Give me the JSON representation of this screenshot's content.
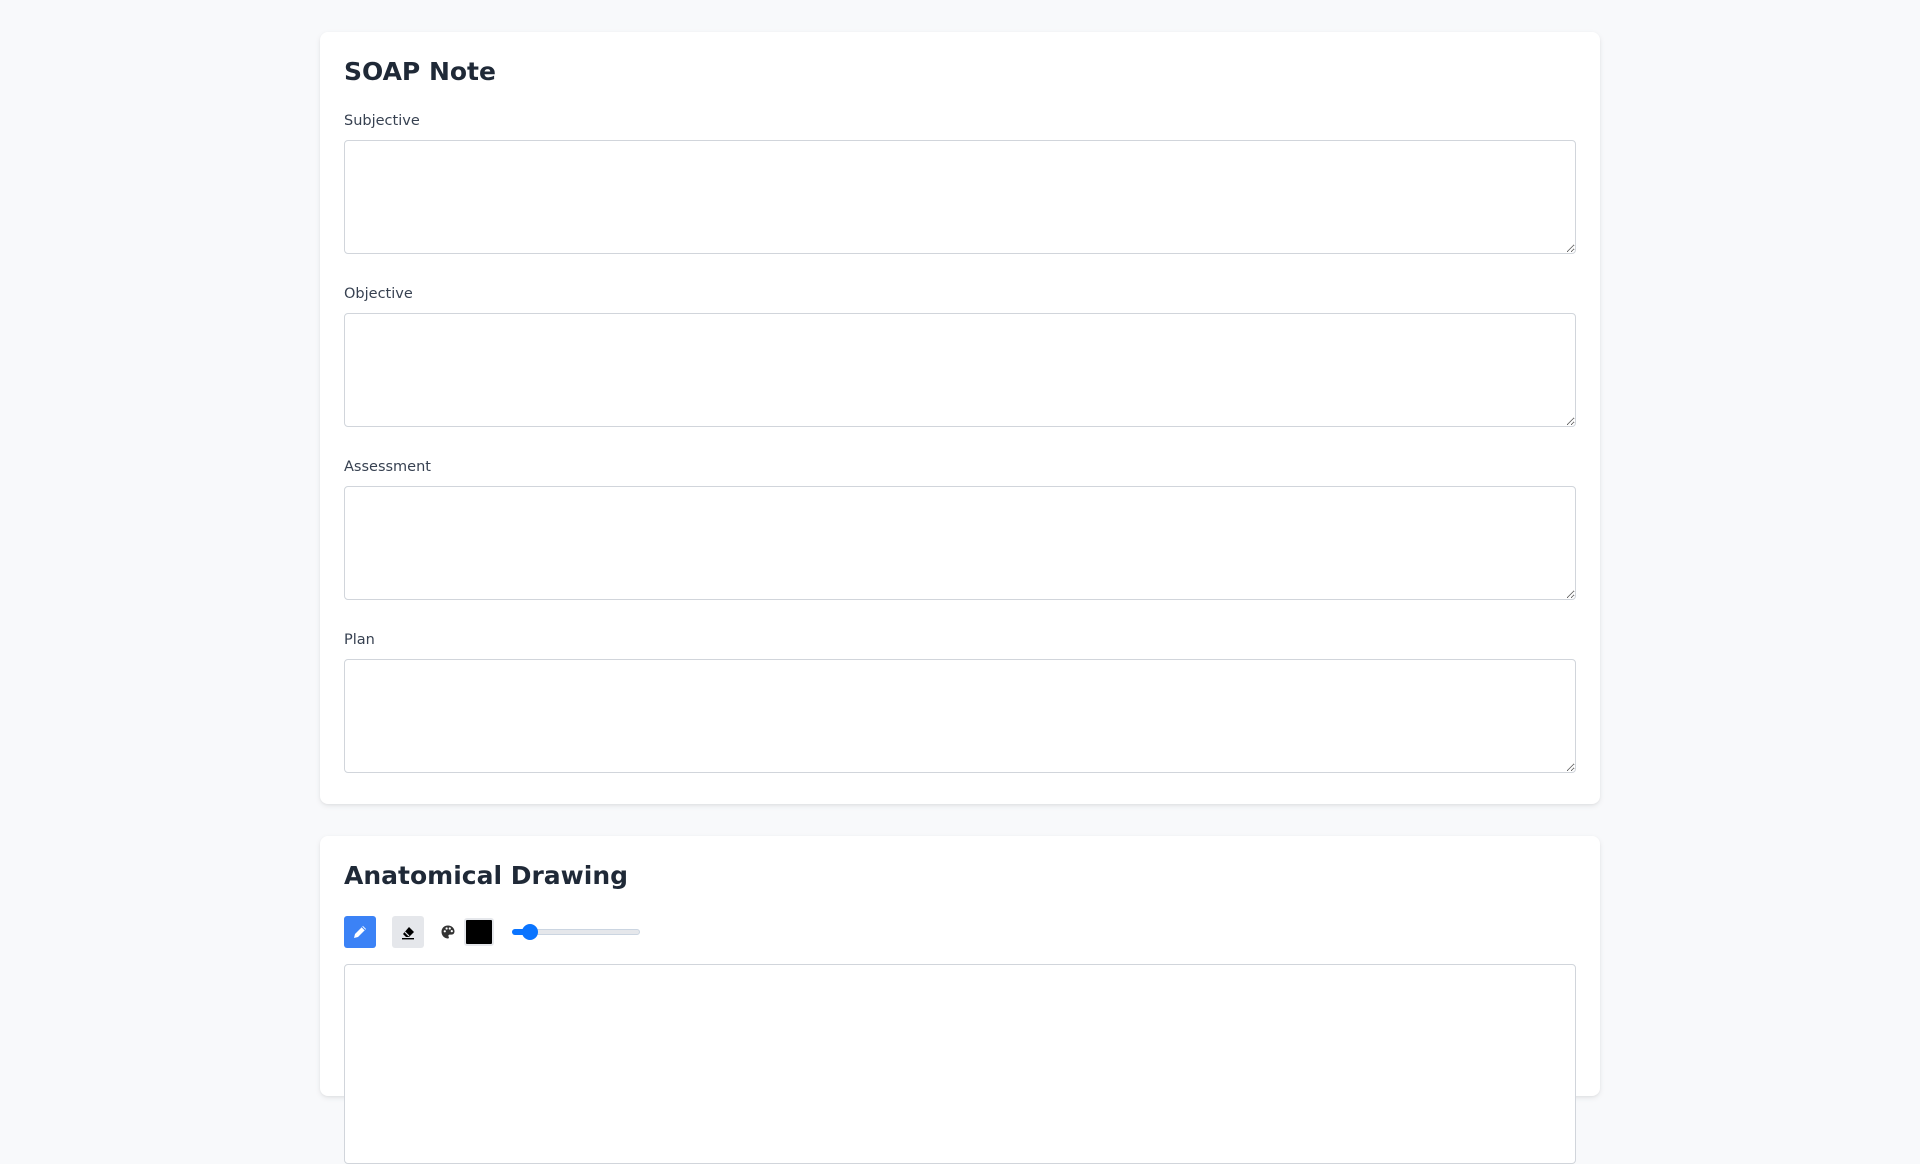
{
  "soap_note": {
    "title": "SOAP Note",
    "fields": [
      {
        "label": "Subjective",
        "value": ""
      },
      {
        "label": "Objective",
        "value": ""
      },
      {
        "label": "Assessment",
        "value": ""
      },
      {
        "label": "Plan",
        "value": ""
      }
    ]
  },
  "drawing": {
    "title": "Anatomical Drawing",
    "tools": {
      "pen": {
        "icon": "pencil-icon",
        "active": true
      },
      "eraser": {
        "icon": "eraser-icon",
        "active": false
      },
      "palette": {
        "icon": "palette-icon"
      },
      "color": "#000000",
      "brush_size_fraction": 0.09
    }
  },
  "colors": {
    "accent": "#3b82f6",
    "slider": "#0a74ff",
    "page_background": "#f8f9fb"
  }
}
